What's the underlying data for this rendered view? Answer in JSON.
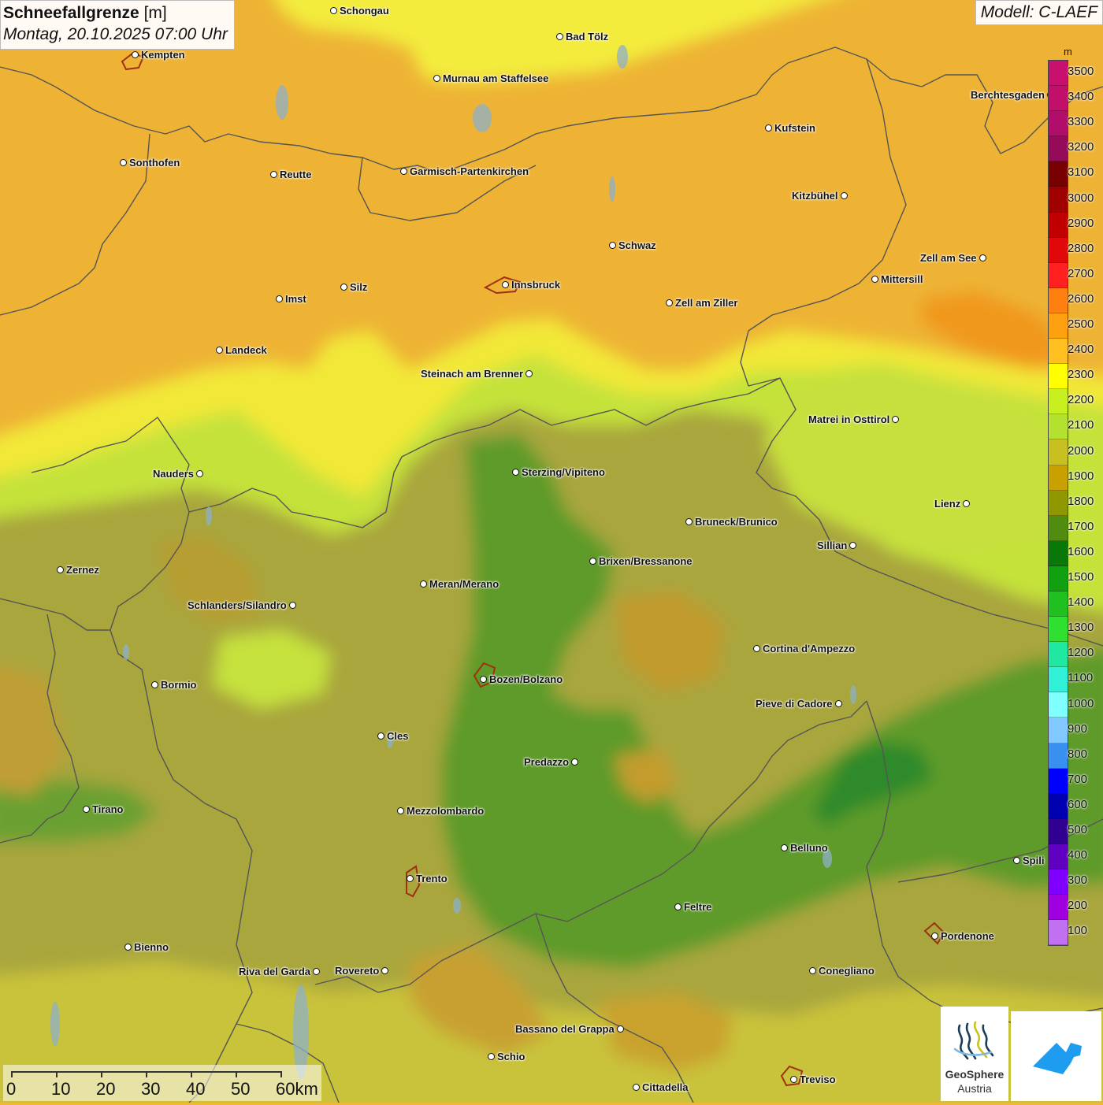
{
  "title": {
    "param": "Schneefallgrenze",
    "unit": "[m]",
    "datetime": "Montag, 20.10.2025 07:00 Uhr",
    "model": "Modell: C-LAEF"
  },
  "legend": {
    "unit": "m",
    "levels": [
      {
        "value": "3500",
        "color": "#c8106e"
      },
      {
        "value": "3400",
        "color": "#c0106a"
      },
      {
        "value": "3300",
        "color": "#b00e6a"
      },
      {
        "value": "3200",
        "color": "#960a5a"
      },
      {
        "value": "3100",
        "color": "#780000"
      },
      {
        "value": "3000",
        "color": "#a00000"
      },
      {
        "value": "2900",
        "color": "#c00000"
      },
      {
        "value": "2800",
        "color": "#e00808"
      },
      {
        "value": "2700",
        "color": "#ff2020"
      },
      {
        "value": "2600",
        "color": "#ff8010"
      },
      {
        "value": "2500",
        "color": "#ffa010"
      },
      {
        "value": "2400",
        "color": "#ffc020"
      },
      {
        "value": "2300",
        "color": "#ffff00"
      },
      {
        "value": "2200",
        "color": "#c8f020"
      },
      {
        "value": "2100",
        "color": "#b4e030"
      },
      {
        "value": "2000",
        "color": "#c8c020"
      },
      {
        "value": "1900",
        "color": "#c8a000"
      },
      {
        "value": "1800",
        "color": "#909800"
      },
      {
        "value": "1700",
        "color": "#508c10"
      },
      {
        "value": "1600",
        "color": "#087808"
      },
      {
        "value": "1500",
        "color": "#10a010"
      },
      {
        "value": "1400",
        "color": "#20c020"
      },
      {
        "value": "1300",
        "color": "#30e030"
      },
      {
        "value": "1200",
        "color": "#20e8a0"
      },
      {
        "value": "1100",
        "color": "#30f0d8"
      },
      {
        "value": "1000",
        "color": "#80ffff"
      },
      {
        "value": "900",
        "color": "#80c8ff"
      },
      {
        "value": "800",
        "color": "#3890f0"
      },
      {
        "value": "700",
        "color": "#0000ff"
      },
      {
        "value": "600",
        "color": "#0000b0"
      },
      {
        "value": "500",
        "color": "#300090"
      },
      {
        "value": "400",
        "color": "#6000c0"
      },
      {
        "value": "300",
        "color": "#8000ff"
      },
      {
        "value": "200",
        "color": "#a000e0"
      },
      {
        "value": "100",
        "color": "#c070f0"
      }
    ]
  },
  "cities": [
    {
      "name": "Schongau",
      "side": "r"
    },
    {
      "name": "Kempten",
      "side": "r"
    },
    {
      "name": "Bad Tölz",
      "side": "r"
    },
    {
      "name": "Murnau am Staffelsee",
      "side": "r"
    },
    {
      "name": "Berchtesgaden",
      "side": "l"
    },
    {
      "name": "Kufstein",
      "side": "r"
    },
    {
      "name": "Sonthofen",
      "side": "r"
    },
    {
      "name": "Reutte",
      "side": "r"
    },
    {
      "name": "Garmisch-Partenkirchen",
      "side": "r"
    },
    {
      "name": "Kitzbühel",
      "side": "l"
    },
    {
      "name": "Schwaz",
      "side": "r"
    },
    {
      "name": "Zell am See",
      "side": "l"
    },
    {
      "name": "Mittersill",
      "side": "r"
    },
    {
      "name": "Innsbruck",
      "side": "r"
    },
    {
      "name": "Zell am Ziller",
      "side": "r"
    },
    {
      "name": "Imst",
      "side": "r"
    },
    {
      "name": "Silz",
      "side": "r"
    },
    {
      "name": "Landeck",
      "side": "r"
    },
    {
      "name": "Steinach am Brenner",
      "side": "l"
    },
    {
      "name": "Matrei in Osttirol",
      "side": "l"
    },
    {
      "name": "Nauders",
      "side": "l"
    },
    {
      "name": "Sterzing/Vipiteno",
      "side": "r"
    },
    {
      "name": "Lienz",
      "side": "l"
    },
    {
      "name": "Bruneck/Brunico",
      "side": "r"
    },
    {
      "name": "Sillian",
      "side": "l"
    },
    {
      "name": "Zernez",
      "side": "r"
    },
    {
      "name": "Brixen/Bressanone",
      "side": "r"
    },
    {
      "name": "Meran/Merano",
      "side": "r"
    },
    {
      "name": "Schlanders/Silandro",
      "side": "l"
    },
    {
      "name": "Cortina d'Ampezzo",
      "side": "r"
    },
    {
      "name": "Bozen/Bolzano",
      "side": "r"
    },
    {
      "name": "Bormio",
      "side": "r"
    },
    {
      "name": "Pieve di Cadore",
      "side": "l"
    },
    {
      "name": "Cles",
      "side": "r"
    },
    {
      "name": "Predazzo",
      "side": "l"
    },
    {
      "name": "Tirano",
      "side": "r"
    },
    {
      "name": "Mezzolombardo",
      "side": "r"
    },
    {
      "name": "Belluno",
      "side": "r"
    },
    {
      "name": "Spili",
      "side": "r"
    },
    {
      "name": "Trento",
      "side": "r"
    },
    {
      "name": "Feltre",
      "side": "r"
    },
    {
      "name": "Pordenone",
      "side": "r"
    },
    {
      "name": "Bienno",
      "side": "r"
    },
    {
      "name": "Riva del Garda",
      "side": "l"
    },
    {
      "name": "Rovereto",
      "side": "l"
    },
    {
      "name": "Conegliano",
      "side": "r"
    },
    {
      "name": "Bassano del Grappa",
      "side": "l"
    },
    {
      "name": "Schio",
      "side": "r"
    },
    {
      "name": "Treviso",
      "side": "r"
    },
    {
      "name": "Cittadella",
      "side": "r"
    }
  ],
  "scale": {
    "labels": [
      "0",
      "10",
      "20",
      "30",
      "40",
      "50",
      "60km"
    ]
  },
  "logos": {
    "geosphere_line1": "GeoSphere",
    "geosphere_line2": "Austria",
    "geosphere_icon": "geosphere-logo-icon",
    "app_icon": "warn-app-logo-icon"
  },
  "colors": {
    "north_orange": "#f0b838",
    "yellow": "#f5ef3a",
    "green": "#5d9a2e",
    "olive": "#a9a43a",
    "border": "#555555",
    "water": "#8eb0c8"
  }
}
